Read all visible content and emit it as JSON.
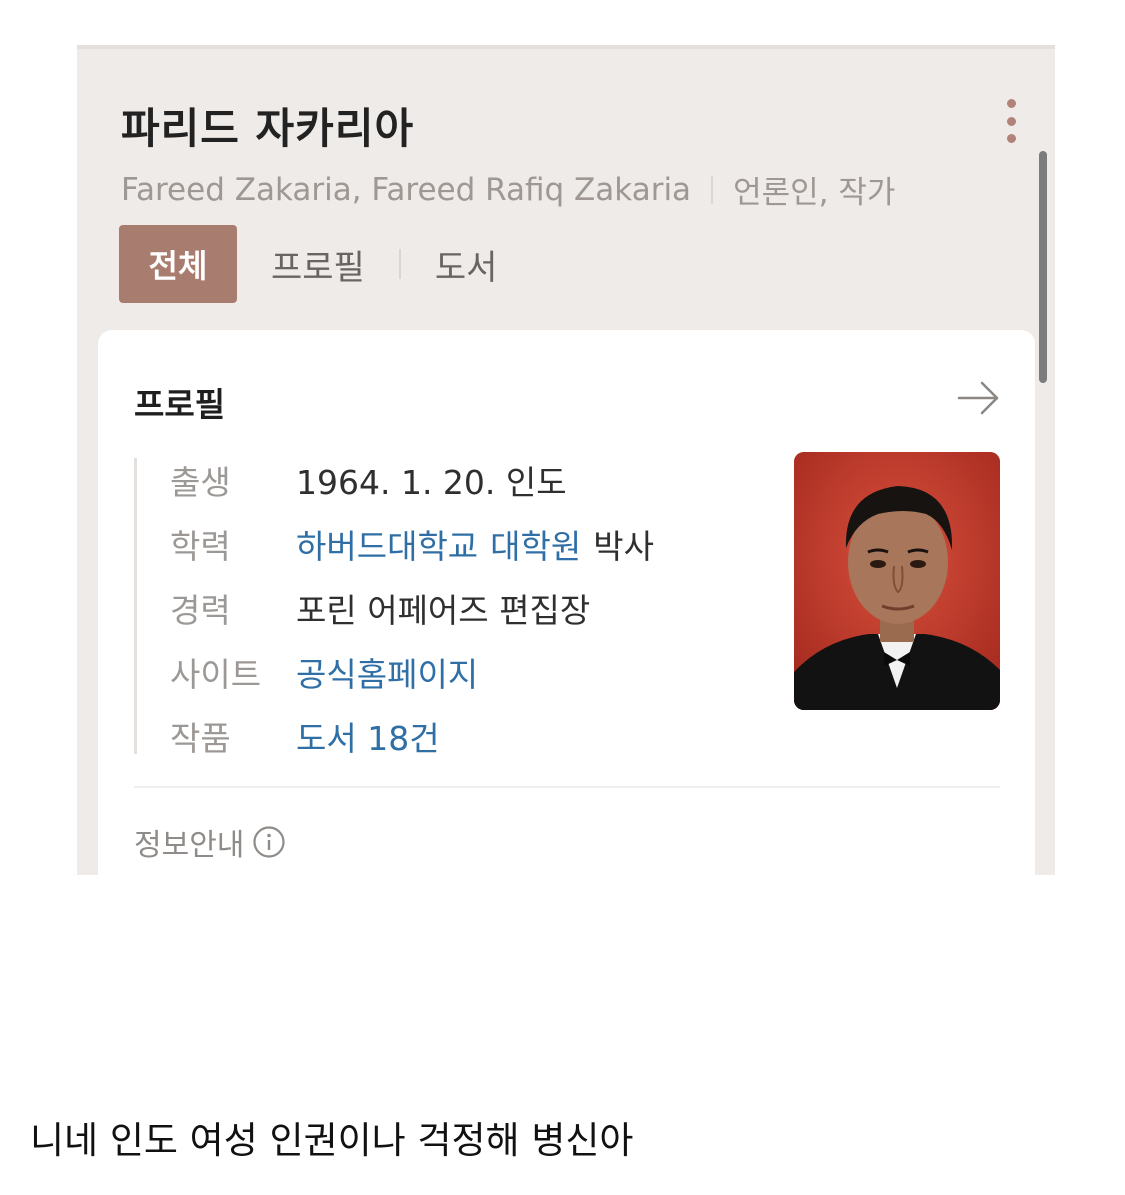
{
  "profile": {
    "name": "파리드 자카리아",
    "aliases": "Fareed Zakaria, Fareed Rafiq Zakaria",
    "occupation": "언론인, 작가",
    "more_icon": "more-vertical-icon"
  },
  "tabs": [
    {
      "label": "전체",
      "active": true
    },
    {
      "label": "프로필",
      "active": false
    },
    {
      "label": "도서",
      "active": false
    }
  ],
  "card": {
    "title": "프로필",
    "arrow_icon": "arrow-right-icon",
    "rows": [
      {
        "label": "출생",
        "value": "1964. 1. 20. 인도"
      },
      {
        "label": "학력",
        "link1": "하버드대학교",
        "link2": "대학원",
        "suffix": "박사"
      },
      {
        "label": "경력",
        "value": "포린 어페어즈 편집장"
      },
      {
        "label": "사이트",
        "link": "공식홈페이지"
      },
      {
        "label": "작품",
        "link": "도서 18건"
      }
    ],
    "footer": "정보안내",
    "footer_icon": "info-circle-icon"
  },
  "caption": "니네 인도 여성 인권이나 걱정해 병신아",
  "colors": {
    "tab_active_bg": "#a97c70",
    "link": "#2f6fa6",
    "background": "#efebe8"
  }
}
